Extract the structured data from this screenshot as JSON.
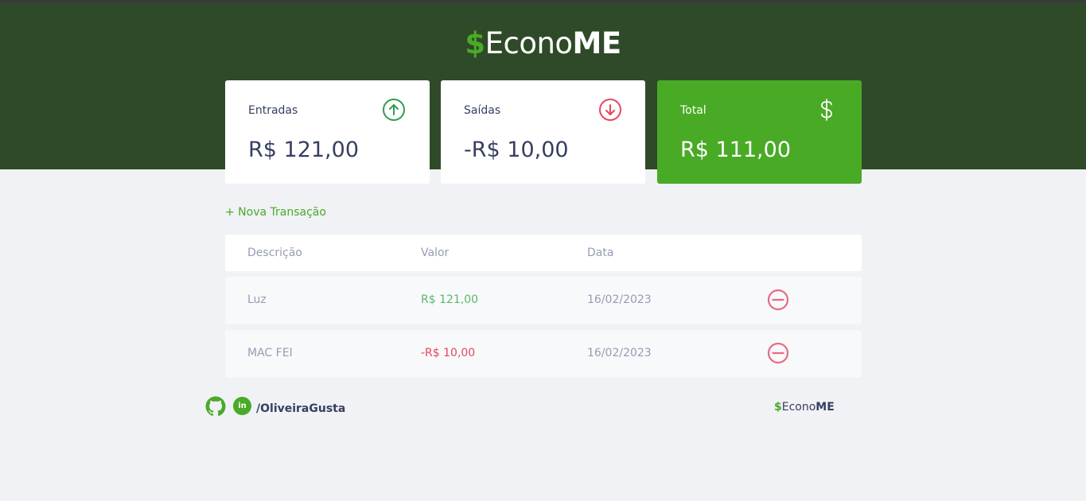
{
  "app": {
    "logo_dollar": "$",
    "logo_econo": "Econo",
    "logo_me": "ME"
  },
  "cards": {
    "income": {
      "title": "Entradas",
      "value": "R$ 121,00",
      "icon": "arrow-up-circle-icon"
    },
    "expense": {
      "title": "Saídas",
      "value": "-R$ 10,00",
      "icon": "arrow-down-circle-icon"
    },
    "total": {
      "title": "Total",
      "value": "R$ 111,00",
      "icon": "dollar-sign-icon"
    }
  },
  "actions": {
    "new_transaction": "+ Nova Transação"
  },
  "table": {
    "headers": [
      "Descrição",
      "Valor",
      "Data"
    ],
    "rows": [
      {
        "description": "Luz",
        "amount": "R$ 121,00",
        "date": "16/02/2023",
        "type": "income"
      },
      {
        "description": "MAC FEI",
        "amount": "-R$ 10,00",
        "date": "16/02/2023",
        "type": "expense"
      }
    ]
  },
  "footer": {
    "handle": "/OliveiraGusta",
    "linkedin_label": "in",
    "logo_dollar": "$",
    "logo_econo": "Econo",
    "logo_me": "ME"
  },
  "colors": {
    "header_bg": "#2f4a28",
    "accent_green": "#49aa26",
    "income_green": "#5bb86c",
    "expense_red": "#e5455f",
    "page_bg": "#f0f2f5"
  }
}
